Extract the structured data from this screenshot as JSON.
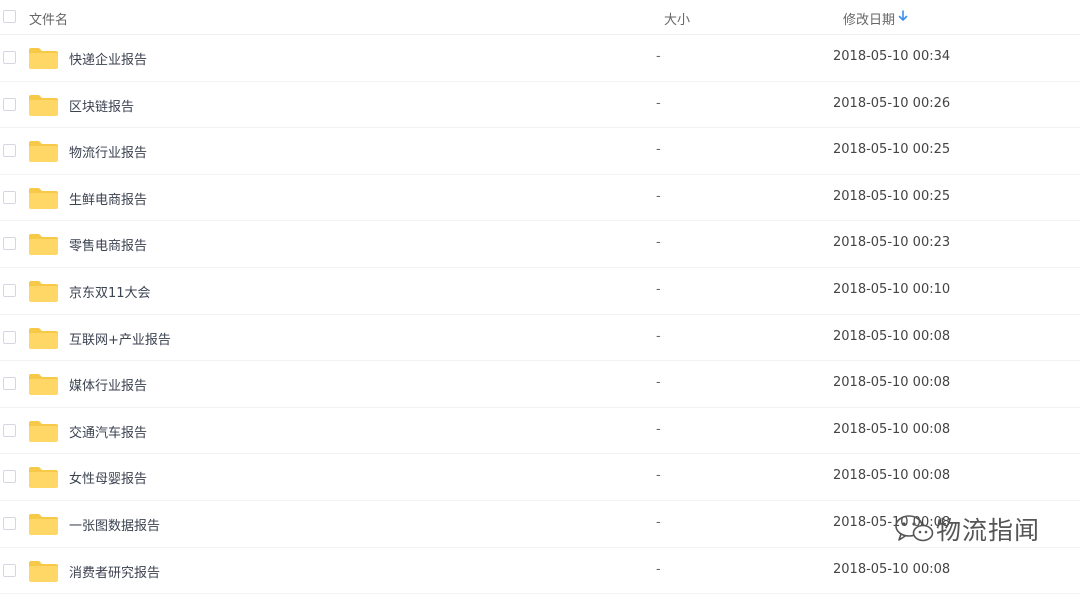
{
  "header": {
    "name_label": "文件名",
    "size_label": "大小",
    "date_label": "修改日期",
    "sort_icon": "arrow-down-icon"
  },
  "colors": {
    "folder": "#ffd766",
    "folder_dark": "#f7c948",
    "sort_arrow": "#3a8fef"
  },
  "files": [
    {
      "name": "快递企业报告",
      "size": "-",
      "date": "2018-05-10 00:34"
    },
    {
      "name": "区块链报告",
      "size": "-",
      "date": "2018-05-10 00:26"
    },
    {
      "name": "物流行业报告",
      "size": "-",
      "date": "2018-05-10 00:25"
    },
    {
      "name": "生鲜电商报告",
      "size": "-",
      "date": "2018-05-10 00:25"
    },
    {
      "name": "零售电商报告",
      "size": "-",
      "date": "2018-05-10 00:23"
    },
    {
      "name": "京东双11大会",
      "size": "-",
      "date": "2018-05-10 00:10"
    },
    {
      "name": "互联网+产业报告",
      "size": "-",
      "date": "2018-05-10 00:08"
    },
    {
      "name": "媒体行业报告",
      "size": "-",
      "date": "2018-05-10 00:08"
    },
    {
      "name": "交通汽车报告",
      "size": "-",
      "date": "2018-05-10 00:08"
    },
    {
      "name": "女性母婴报告",
      "size": "-",
      "date": "2018-05-10 00:08"
    },
    {
      "name": "一张图数据报告",
      "size": "-",
      "date": "2018-05-10 00:08"
    },
    {
      "name": "消费者研究报告",
      "size": "-",
      "date": "2018-05-10 00:08"
    }
  ],
  "watermark": {
    "text": "物流指闻",
    "icon": "wechat-icon"
  }
}
